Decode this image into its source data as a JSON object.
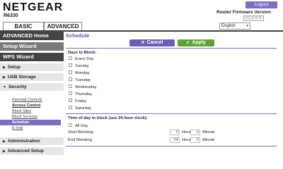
{
  "header": {
    "logo": "NETGEAR",
    "model": "R6330",
    "logout_label": "Logout",
    "firmware_label": "Router Firmware Version",
    "firmware_version": "V1.0.0.5",
    "language": "English"
  },
  "tabs": {
    "basic": "BASIC",
    "advanced": "ADVANCED"
  },
  "sidebar": {
    "advanced_home": "ADVANCED Home",
    "setup_wizard": "Setup Wizard",
    "wps_wizard": "WPS Wizard",
    "setup": "Setup",
    "usb_storage": "USB Storage",
    "security": "Security",
    "security_items": [
      "Parental Controls",
      "Access Control",
      "Block Sites",
      "Block Services",
      "Schedule",
      "E-mail"
    ],
    "administration": "Administration",
    "advanced_setup": "Advanced Setup"
  },
  "main": {
    "title": "Schedule",
    "cancel_label": "Cancel",
    "apply_label": "Apply",
    "days_label": "Days to Block:",
    "days": [
      "Every Day",
      "Sunday",
      "Monday",
      "Tuesday",
      "Wednesday",
      "Thursday",
      "Friday",
      "Saturday"
    ],
    "time_label": "Time of day to block (use 24-hour clock):",
    "all_day": "All Day",
    "start_label": "Start Blocking",
    "end_label": "End Blocking",
    "start_hour": "0",
    "start_minute": "0",
    "end_hour": "24",
    "end_minute": "0",
    "hour_unit": "Hour",
    "minute_unit": "Minute"
  }
}
